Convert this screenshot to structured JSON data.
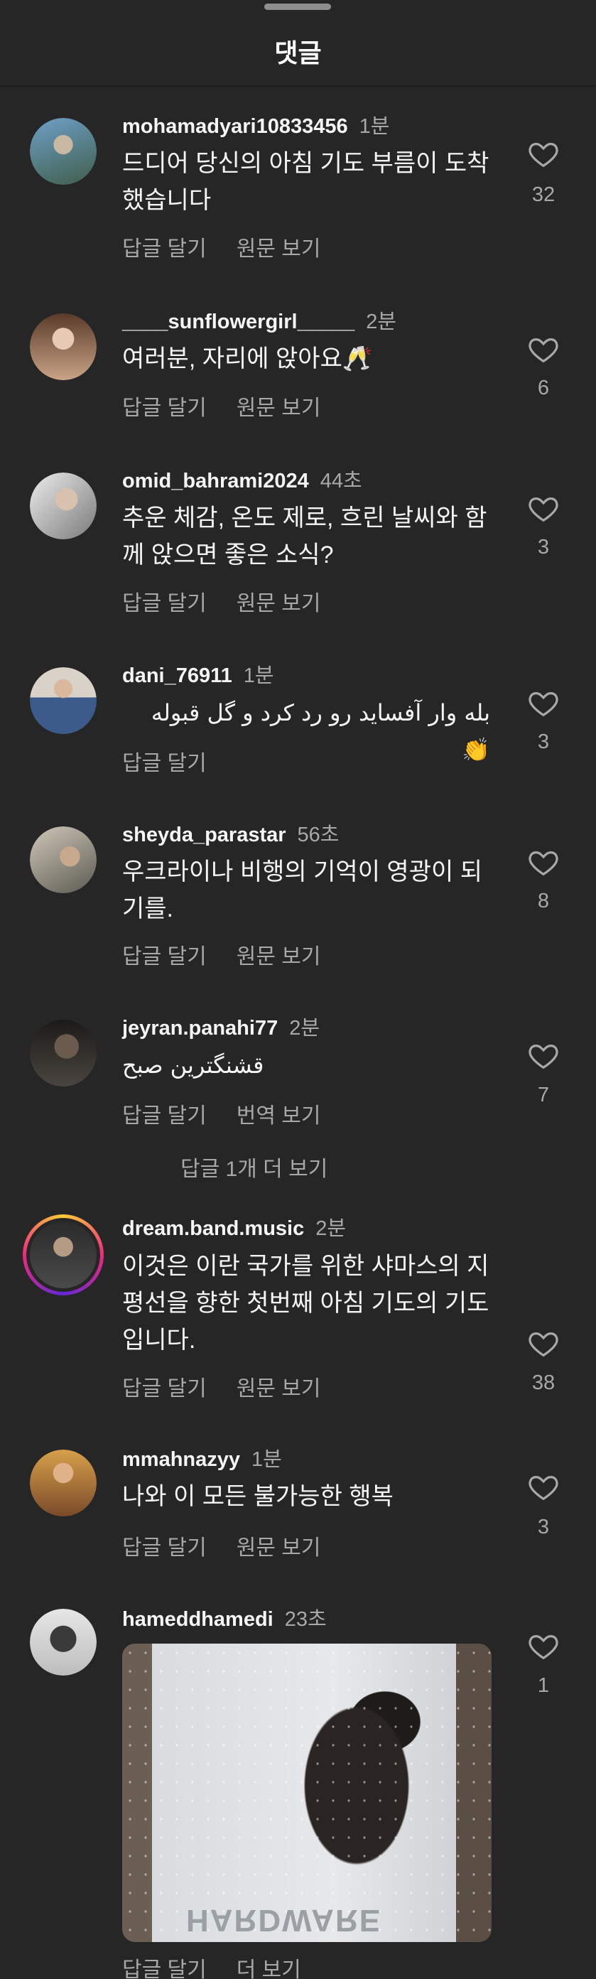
{
  "header": {
    "title": "댓글"
  },
  "comments": [
    {
      "username": "mohamadyari10833456",
      "time": "1분",
      "text": "드디어 당신의 아침 기도 부름이 도착했습니다",
      "reply": "답글 달기",
      "secondary": "원문 보기",
      "likes": "32",
      "avatar_color": "#4a6f8f"
    },
    {
      "username": "____sunflowergirl_____",
      "time": "2분",
      "text": "여러분, 자리에 앉아요🥂",
      "reply": "답글 달기",
      "secondary": "원문 보기",
      "likes": "6",
      "avatar_color": "#b08a6e"
    },
    {
      "username": "omid_bahrami2024",
      "time": "44초",
      "text": "추운 체감, 온도 제로, 흐린 날씨와 함께 앉으면 좋은 소식?",
      "reply": "답글 달기",
      "secondary": "원문 보기",
      "likes": "3",
      "avatar_color": "#8c8c8c"
    },
    {
      "username": "dani_76911",
      "time": "1분",
      "text": "بله وار آفساید رو رد کرد و گل قبوله 👏",
      "reply": "답글 달기",
      "secondary": "",
      "likes": "3",
      "avatar_color": "#8a7f74"
    },
    {
      "username": "sheyda_parastar",
      "time": "56초",
      "text": "우크라이나 비행의 기억이 영광이 되기를.",
      "reply": "답글 달기",
      "secondary": "원문 보기",
      "likes": "8",
      "avatar_color": "#a39a88"
    },
    {
      "username": "jeyran.panahi77",
      "time": "2분",
      "text": "قشنگترین صبح",
      "reply": "답글 달기",
      "secondary": "번역 보기",
      "likes": "7",
      "more_replies": "답글 1개 더 보기",
      "avatar_color": "#3a3632"
    },
    {
      "username": "dream.band.music",
      "time": "2분",
      "text": "이것은 이란 국가를 위한 샤마스의 지평선을 향한 첫번째 아침 기도의 기도입니다.",
      "reply": "답글 달기",
      "secondary": "원문 보기",
      "likes": "38",
      "avatar_color": "#3b3b3b"
    },
    {
      "username": "mmahnazyy",
      "time": "1분",
      "text": "나와 이 모든 불가능한 행복",
      "reply": "답글 달기",
      "secondary": "원문 보기",
      "likes": "3",
      "avatar_color": "#c8954a"
    },
    {
      "username": "hameddhamedi",
      "time": "23초",
      "gif_caption": "HARDWARE",
      "reply": "답글 달기",
      "secondary": "더 보기",
      "likes": "1",
      "avatar_color": "#d6d6d6"
    }
  ]
}
